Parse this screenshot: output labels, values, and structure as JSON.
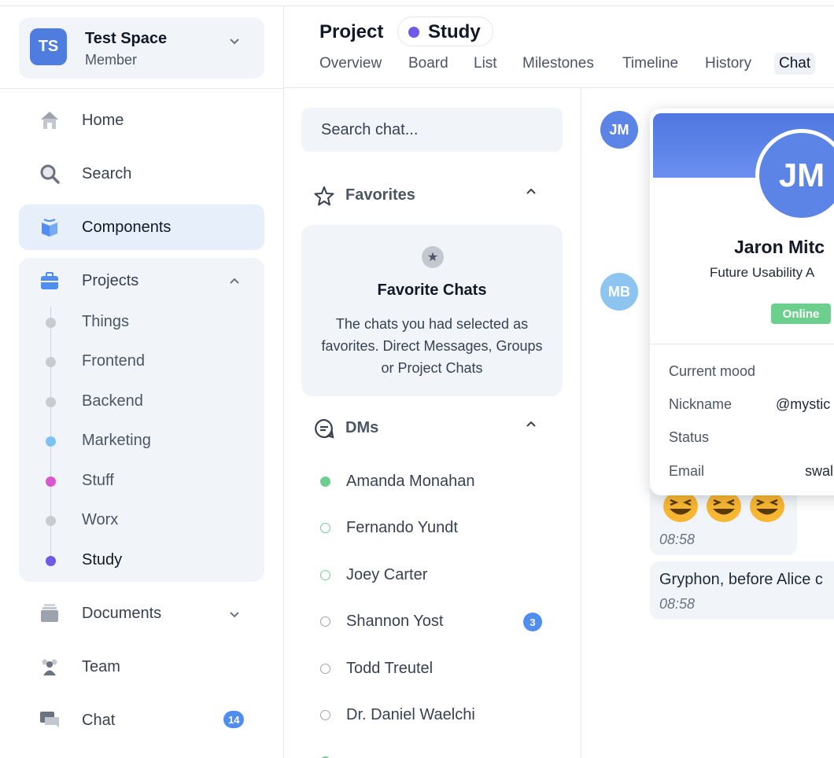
{
  "workspace": {
    "initials": "TS",
    "name": "Test Space",
    "role": "Member"
  },
  "sidebar": {
    "items": [
      {
        "label": "Home",
        "icon": "home-icon"
      },
      {
        "label": "Search",
        "icon": "search-icon"
      },
      {
        "label": "Components",
        "icon": "components-icon"
      }
    ],
    "projects": {
      "label": "Projects",
      "children": [
        {
          "label": "Things",
          "color": "#c8cbd0"
        },
        {
          "label": "Frontend",
          "color": "#c8cbd0"
        },
        {
          "label": "Backend",
          "color": "#c8cbd0"
        },
        {
          "label": "Marketing",
          "color": "#7cc3f2"
        },
        {
          "label": "Stuff",
          "color": "#d958cf"
        },
        {
          "label": "Worx",
          "color": "#c8cbd0"
        },
        {
          "label": "Study",
          "color": "#6d5ae6"
        }
      ]
    },
    "bottom": [
      {
        "label": "Documents",
        "icon": "documents-icon"
      },
      {
        "label": "Team",
        "icon": "team-icon"
      },
      {
        "label": "Chat",
        "icon": "chat-icon",
        "badge": "14"
      }
    ]
  },
  "header": {
    "title": "Project",
    "project_name": "Study",
    "project_color": "#6d5ae6",
    "tabs": [
      "Overview",
      "Board",
      "List",
      "Milestones",
      "Timeline",
      "History",
      "Chat"
    ],
    "active_tab": "Chat"
  },
  "chatlist": {
    "search_placeholder": "Search chat...",
    "favorites": {
      "label": "Favorites",
      "empty_title": "Favorite Chats",
      "empty_desc": "The chats you had selected as favorites. Direct Messages, Groups or Project Chats"
    },
    "dms": {
      "label": "DMs",
      "items": [
        {
          "name": "Amanda Monahan",
          "online": true
        },
        {
          "name": "Fernando Yundt",
          "online": false,
          "ring": "#6dcf8e"
        },
        {
          "name": "Joey Carter",
          "online": false,
          "ring": "#6dcf8e"
        },
        {
          "name": "Shannon Yost",
          "online": false,
          "ring": "#9ca3af",
          "badge": "3"
        },
        {
          "name": "Todd Treutel",
          "online": false,
          "ring": "#9ca3af"
        },
        {
          "name": "Dr. Daniel Waelchi",
          "online": false,
          "ring": "#9ca3af"
        }
      ]
    }
  },
  "chat": {
    "avatars": [
      {
        "initials": "JM",
        "color": "#5b84e6"
      },
      {
        "initials": "MB",
        "color": "#8ec5f0"
      }
    ],
    "messages": [
      {
        "emojis": [
          "😆",
          "😆",
          "😆"
        ],
        "time": "08:58"
      },
      {
        "text": "Gryphon, before Alice c",
        "time": "08:58"
      }
    ]
  },
  "profile": {
    "initials": "JM",
    "name": "Jaron Mitc",
    "title": "Future Usability A",
    "status": "Online",
    "fields": [
      {
        "label": "Current mood",
        "value": ""
      },
      {
        "label": "Nickname",
        "value": "@mystic"
      },
      {
        "label": "Status",
        "value": ""
      },
      {
        "label": "Email",
        "value": "swal"
      }
    ]
  }
}
